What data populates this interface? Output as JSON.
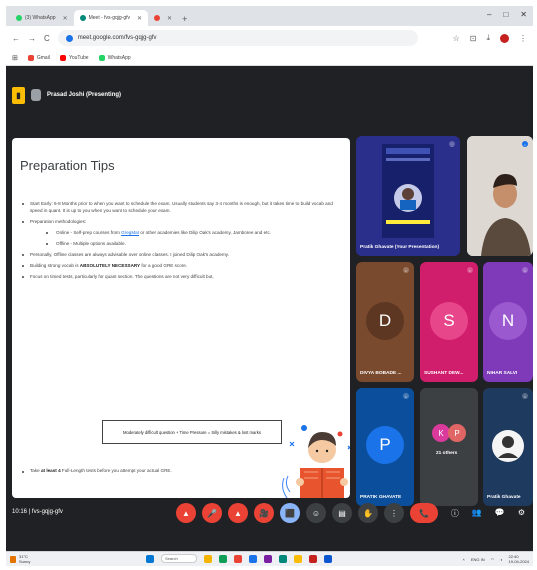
{
  "browser": {
    "tabs": [
      {
        "label": "(3) WhatsApp",
        "color": "#25d366"
      },
      {
        "label": "Meet - fvs-gqjg-gfv",
        "color": "#00897b",
        "active": true
      },
      {
        "label": "",
        "color": "#ea4335"
      }
    ],
    "window_controls": [
      "–",
      "□",
      "✕"
    ],
    "url": "meet.google.com/fvs-gqjg-gfv",
    "nav": [
      "←",
      "→",
      "C"
    ],
    "right_icons": [
      "☆",
      "⊡",
      "⤓",
      "⋮"
    ]
  },
  "bookmarks": [
    {
      "label": "Gmail",
      "color": "#ea4335"
    },
    {
      "label": "YouTube",
      "color": "#ff0000"
    },
    {
      "label": "WhatsApp",
      "color": "#25d366"
    }
  ],
  "meet": {
    "presenting": "Prasad Joshi (Presenting)",
    "meeting_code": "10:16 | fvs-gqjg-gfv",
    "slide": {
      "title": "Preparation Tips",
      "bullets": [
        {
          "text": "Start Early: 6-8 Months prior to when you want to schedule the exam. Usually students say 3-4 months is enough, but it takes time to build vocab and speed in quant. It is up to you when you want to schedule your exam.",
          "level": 1
        },
        {
          "text": "Preparation methodologies:",
          "level": 1
        },
        {
          "text_before": "Online - Self-prep courses from ",
          "link": "GregMat",
          "text_after": " or other academies like Dilip Oak's academy, Jamboree and etc.",
          "level": 2
        },
        {
          "text": "Offline - Multiple options available.",
          "level": 2
        },
        {
          "text": "Personally, Offline classes are always advisable over online classes. I joined Dilip Oak's academy.",
          "level": 1
        },
        {
          "text_before": "Building strong vocab is ",
          "bold": "ABSOLUTELY NECESSARY",
          "text_after": " for a good GRE score.",
          "level": 1
        },
        {
          "text": "Focus on timed tests, particularly for quant section. The questions are not very difficult but,",
          "level": 1
        }
      ],
      "formula": "Moderately difficult question + Time Pressure = Silly mistakes & lost marks",
      "last_before": "Take ",
      "last_bold": "at least 4",
      "last_after": " Full-Length tests before you attempt your actual GRE."
    },
    "participants": [
      {
        "name": "Pratik Ghavate (Your Presentation)",
        "initial": "",
        "color": "#2b2f8c",
        "type": "screen"
      },
      {
        "name": "",
        "initial": "",
        "color": "#e8e6e3",
        "type": "camera"
      },
      {
        "name": "DIVYA BOBADE ...",
        "initial": "D",
        "color": "#7a4a2e"
      },
      {
        "name": "SUSHANT DEW...",
        "initial": "S",
        "color": "#d01d6c"
      },
      {
        "name": "NIHAR SALVI",
        "initial": "N",
        "color": "#7e3ab8"
      },
      {
        "name": "PRATIK GHAVATE",
        "initial": "P",
        "color": "#1a73e8"
      },
      {
        "name": "21 others",
        "initial": "KP",
        "color": "#3c4043"
      },
      {
        "name": "Pratik Ghavate",
        "initial": "",
        "color": "#1e3a5f"
      }
    ],
    "controls": [
      "▲",
      "🎤",
      "▲",
      "🎥",
      "⬛",
      "☺",
      "▤",
      "✋",
      "⋮",
      "📞"
    ],
    "right_controls": [
      "ⓘ",
      "👥",
      "💬",
      "⚙"
    ]
  },
  "taskbar": {
    "weather_temp": "31°C",
    "weather_desc": "Sunny",
    "search": "Search",
    "apps": [
      "#0078d4",
      "#f4b400",
      "#0f9d58",
      "#ea4335",
      "#1a73e8",
      "#7b1fa2",
      "#00897b",
      "#fbbc04",
      "#c5221f",
      "#0b57d0"
    ],
    "lang": "ENG IN",
    "time": "22:40",
    "date": "19-04-2024"
  }
}
